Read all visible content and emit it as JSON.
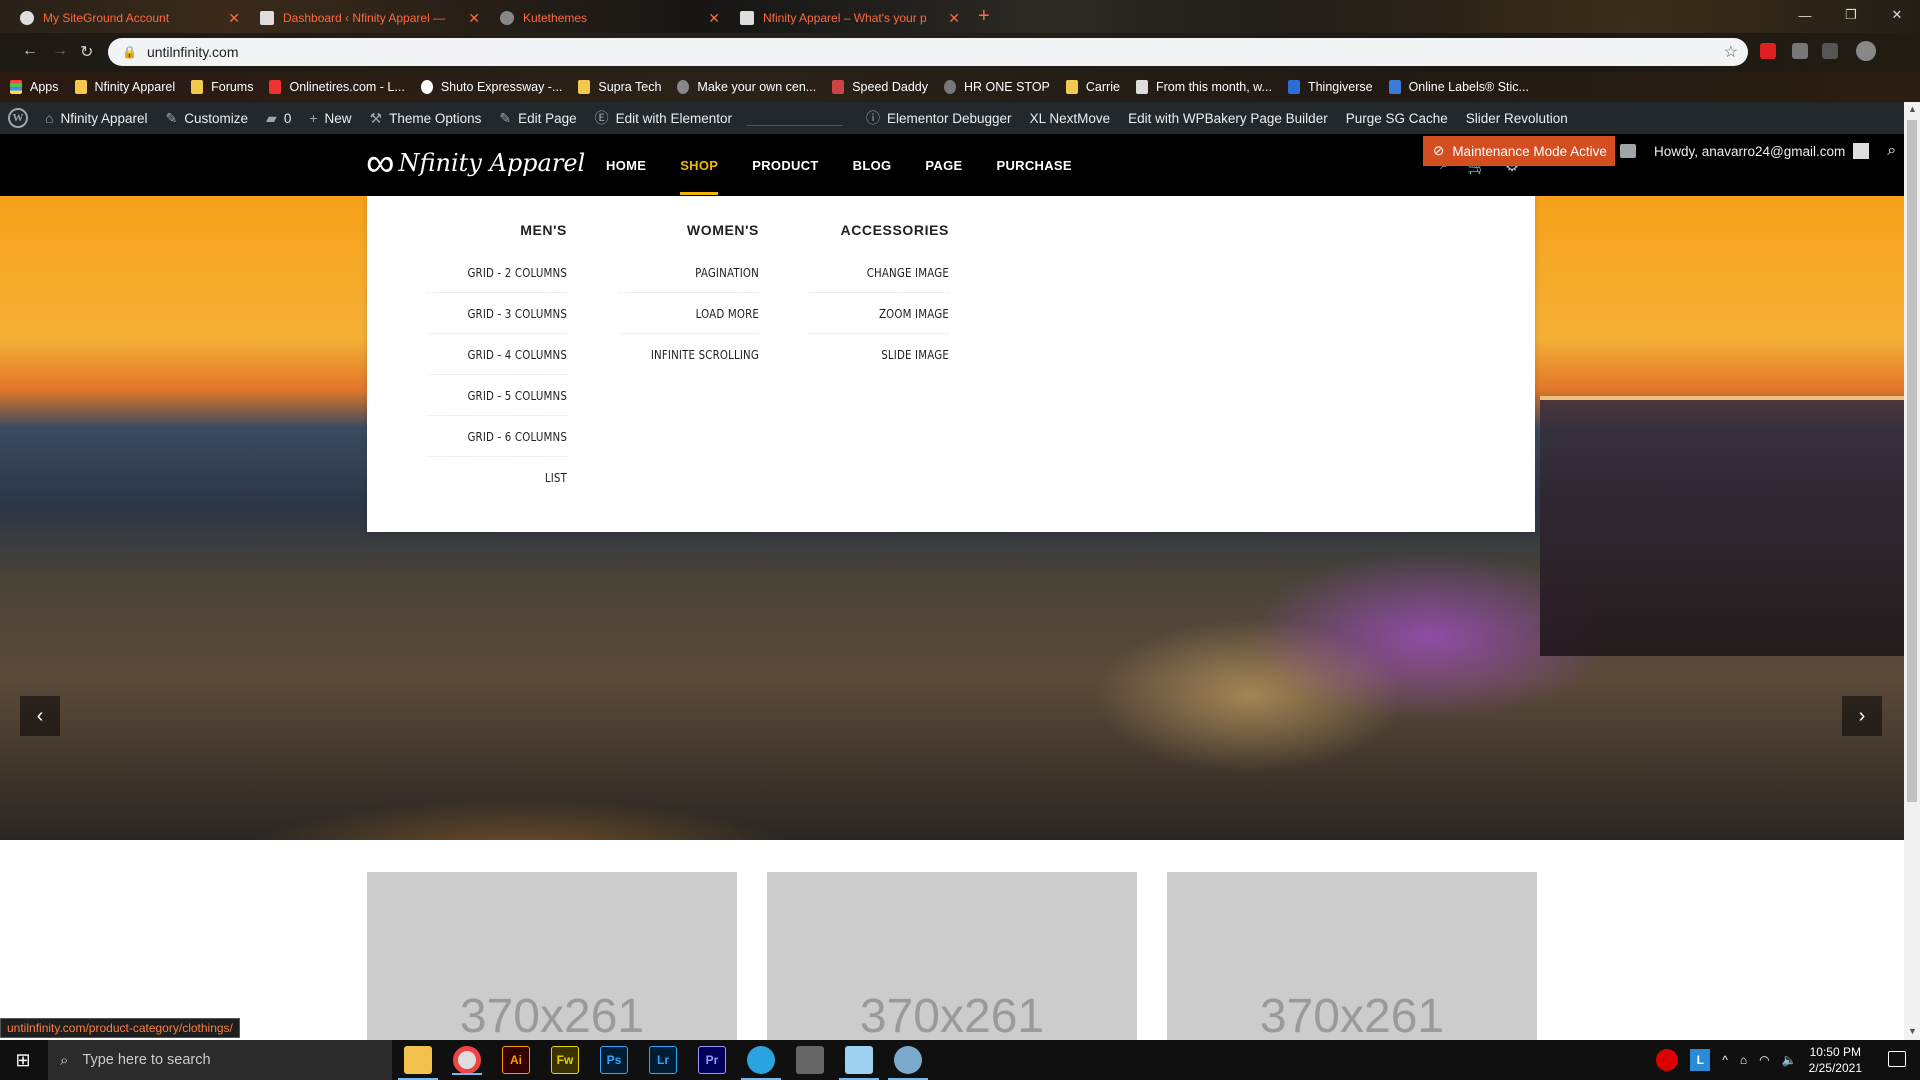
{
  "browser": {
    "tabs": [
      {
        "title": "My SiteGround Account"
      },
      {
        "title": "Dashboard ‹ Nfinity Apparel —"
      },
      {
        "title": "Kutethemes"
      },
      {
        "title": "Nfinity Apparel – What's your p"
      }
    ],
    "new_tab": "+",
    "url": "untilnfinity.com",
    "bookmarks": [
      "Apps",
      "Nfinity Apparel",
      "Forums",
      "Onlinetires.com - L...",
      "Shuto Expressway -...",
      "Supra Tech",
      "Make your own cen...",
      "Speed Daddy",
      "HR ONE STOP",
      "Carrie",
      "From this month, w...",
      "Thingiverse",
      "Online Labels® Stic..."
    ],
    "status_url": "untilnfinity.com/product-category/clothings/"
  },
  "adminbar": {
    "site_name": "Nfinity Apparel",
    "customize": "Customize",
    "comments_count": "0",
    "new": "New",
    "theme_options": "Theme Options",
    "edit_page": "Edit Page",
    "edit_elementor": "Edit with Elementor",
    "elementor_debugger": "Elementor Debugger",
    "xl_nextmove": "XL NextMove",
    "wpbakery": "Edit with WPBakery Page Builder",
    "purge": "Purge SG Cache",
    "slider_rev": "Slider Revolution",
    "maintenance": "Maintenance Mode Active",
    "howdy": "Howdy, anavarro24@gmail.com"
  },
  "site": {
    "logo_text": "Nfinity Apparel",
    "nav": [
      "HOME",
      "SHOP",
      "PRODUCT",
      "BLOG",
      "PAGE",
      "PURCHASE"
    ],
    "active_nav": "SHOP"
  },
  "megamenu": {
    "mens": {
      "title": "MEN'S",
      "items": [
        "Grid - 2 Columns",
        "Grid - 3 Columns",
        "Grid - 4 Columns",
        "Grid - 5 Columns",
        "Grid - 6 Columns",
        "List"
      ]
    },
    "womens": {
      "title": "WOMEN'S",
      "items": [
        "Pagination",
        "Load More",
        "Infinite Scrolling"
      ]
    },
    "accessories": {
      "title": "ACCESSORIES",
      "items": [
        "Change Image",
        "Zoom Image",
        "Slide Image"
      ]
    }
  },
  "products": [
    "370x261",
    "370x261",
    "370x261"
  ],
  "taskbar": {
    "search_placeholder": "Type here to search",
    "apps": [
      "Ai",
      "Fw",
      "Ps",
      "Lr",
      "Pr"
    ],
    "time": "10:50 PM",
    "date": "2/25/2021"
  },
  "colors": {
    "admin_bar": "#23282d",
    "nav_active": "#f3b700",
    "maintenance": "#d54e21",
    "tab_text": "#ff6a3c"
  }
}
